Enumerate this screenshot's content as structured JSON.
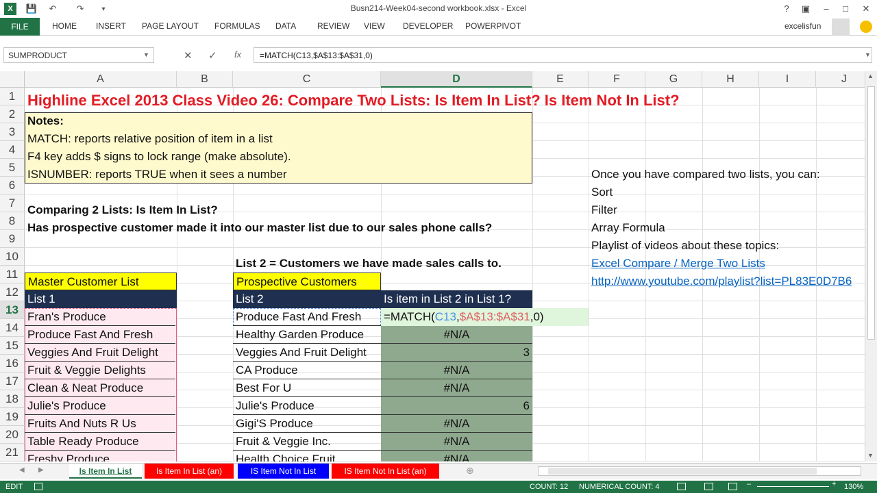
{
  "window": {
    "title": "Busn214-Week04-second workbook.xlsx - Excel",
    "user": "excelisfun",
    "help": "?"
  },
  "ribbon": {
    "file": "FILE",
    "tabs": [
      "HOME",
      "INSERT",
      "PAGE LAYOUT",
      "FORMULAS",
      "DATA",
      "REVIEW",
      "VIEW",
      "DEVELOPER",
      "POWERPIVOT"
    ]
  },
  "formula_bar": {
    "name_box": "SUMPRODUCT",
    "formula": "=MATCH(C13,$A$13:$A$31,0)",
    "fx": "fx"
  },
  "columns": [
    "A",
    "B",
    "C",
    "D",
    "E",
    "F",
    "G",
    "H",
    "I",
    "J"
  ],
  "rows": [
    "1",
    "2",
    "3",
    "4",
    "5",
    "6",
    "7",
    "8",
    "9",
    "10",
    "11",
    "12",
    "13",
    "14",
    "15",
    "16",
    "17",
    "18",
    "19",
    "20",
    "21"
  ],
  "cells": {
    "r1": "Highline Excel 2013 Class Video 26: Compare Two Lists: Is Item In List? Is Item Not In List?",
    "r2": "Notes:",
    "r3": "MATCH: reports relative position of item in a list",
    "r4": "F4 key adds $ signs to lock range (make absolute).",
    "r5": "ISNUMBER: reports TRUE when it sees a number",
    "r7": "Comparing 2 Lists: Is Item In List?",
    "r8": "Has prospective customer made it into our master list due to our sales phone calls?",
    "r10c": "List 2 = Customers we have made sales calls to.",
    "a11": "Master Customer List",
    "a12": "List 1",
    "c11": "Prospective Customers",
    "c12": "List 2",
    "d12": "Is item in List 2 in List 1?",
    "f5": "Once you have compared two lists, you can:",
    "f6": "Sort",
    "f7": "Filter",
    "f8": "Array Formula",
    "f9": "Playlist of videos about these topics:",
    "f10": "Excel Compare / Merge Two Lists",
    "f11": "http://www.youtube.com/playlist?list=PL83E0D7B6"
  },
  "list1": [
    "Fran's  Produce",
    "Produce Fast And Fresh",
    "Veggies And Fruit Delight",
    "Fruit & Veggie Delights",
    "Clean & Neat  Produce",
    "Julie's Produce",
    "Fruits And Nuts R Us",
    "Table Ready Produce",
    "Freshy Produce"
  ],
  "list2": [
    "Produce Fast And Fresh",
    "Healthy Garden Produce",
    "Veggies And Fruit Delight",
    "CA Produce",
    "Best For U",
    "Julie's Produce",
    "Gigi'S Produce",
    "Fruit & Veggie Inc.",
    "Health Choice Fruit"
  ],
  "match_results": [
    "",
    "#N/A",
    "3",
    "#N/A",
    "#N/A",
    "6",
    "#N/A",
    "#N/A",
    "#N/A"
  ],
  "edit_formula": {
    "prefix": "=MATCH(",
    "arg1": "C13",
    "comma1": ",",
    "arg2": "$A$13:$A$31",
    "suffix": ",0)"
  },
  "sheet_tabs": [
    "Is Item In List",
    "Is Item In List (an)",
    "IS Item Not In List",
    "IS Item Not In List (an)"
  ],
  "status": {
    "mode": "EDIT",
    "count": "COUNT: 12",
    "num_count": "NUMERICAL COUNT: 4",
    "zoom": "130%"
  }
}
